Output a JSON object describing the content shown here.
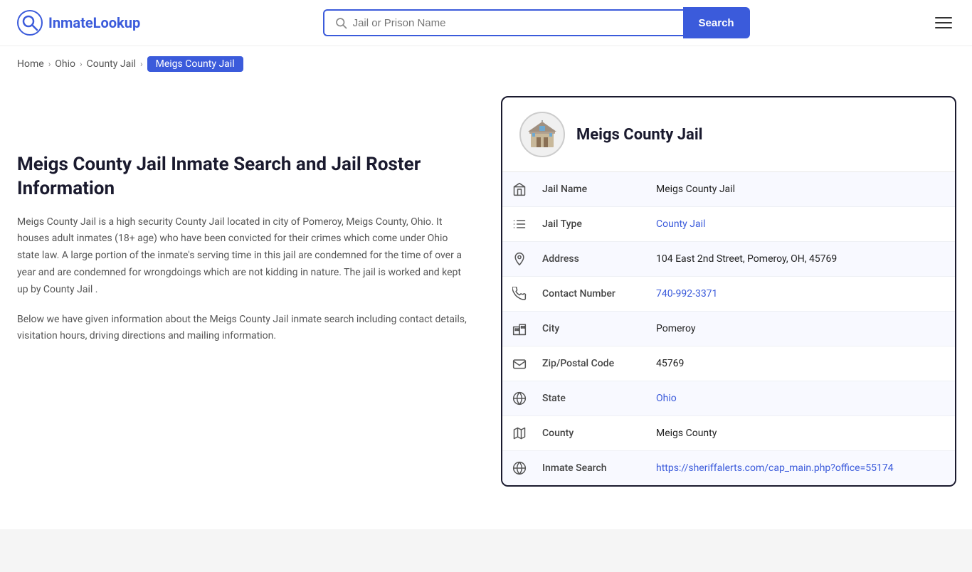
{
  "header": {
    "logo_text_part1": "Inmate",
    "logo_text_part2": "Lookup",
    "search_placeholder": "Jail or Prison Name",
    "search_button_label": "Search",
    "menu_label": "Menu"
  },
  "breadcrumb": {
    "home": "Home",
    "ohio": "Ohio",
    "county_jail": "County Jail",
    "current": "Meigs County Jail"
  },
  "left": {
    "title": "Meigs County Jail Inmate Search and Jail Roster Information",
    "description1": "Meigs County Jail is a high security County Jail located in city of Pomeroy, Meigs County, Ohio. It houses adult inmates (18+ age) who have been convicted for their crimes which come under Ohio state law. A large portion of the inmate's serving time in this jail are condemned for the time of over a year and are condemned for wrongdoings which are not kidding in nature. The jail is worked and kept up by County Jail .",
    "description2": "Below we have given information about the Meigs County Jail inmate search including contact details, visitation hours, driving directions and mailing information."
  },
  "card": {
    "title": "Meigs County Jail",
    "rows": [
      {
        "id": "jail-name",
        "icon": "building",
        "label": "Jail Name",
        "value": "Meigs County Jail",
        "link": null
      },
      {
        "id": "jail-type",
        "icon": "list",
        "label": "Jail Type",
        "value": "County Jail",
        "link": "#"
      },
      {
        "id": "address",
        "icon": "location",
        "label": "Address",
        "value": "104 East 2nd Street, Pomeroy, OH, 45769",
        "link": null
      },
      {
        "id": "contact",
        "icon": "phone",
        "label": "Contact Number",
        "value": "740-992-3371",
        "link": "tel:7409923371"
      },
      {
        "id": "city",
        "icon": "city",
        "label": "City",
        "value": "Pomeroy",
        "link": null
      },
      {
        "id": "zip",
        "icon": "mail",
        "label": "Zip/Postal Code",
        "value": "45769",
        "link": null
      },
      {
        "id": "state",
        "icon": "globe",
        "label": "State",
        "value": "Ohio",
        "link": "#"
      },
      {
        "id": "county",
        "icon": "map",
        "label": "County",
        "value": "Meigs County",
        "link": null
      },
      {
        "id": "inmate-search",
        "icon": "globe2",
        "label": "Inmate Search",
        "value": "https://sheriffalerts.com/cap_main.php?office=55174",
        "link": "https://sheriffalerts.com/cap_main.php?office=55174"
      }
    ]
  }
}
